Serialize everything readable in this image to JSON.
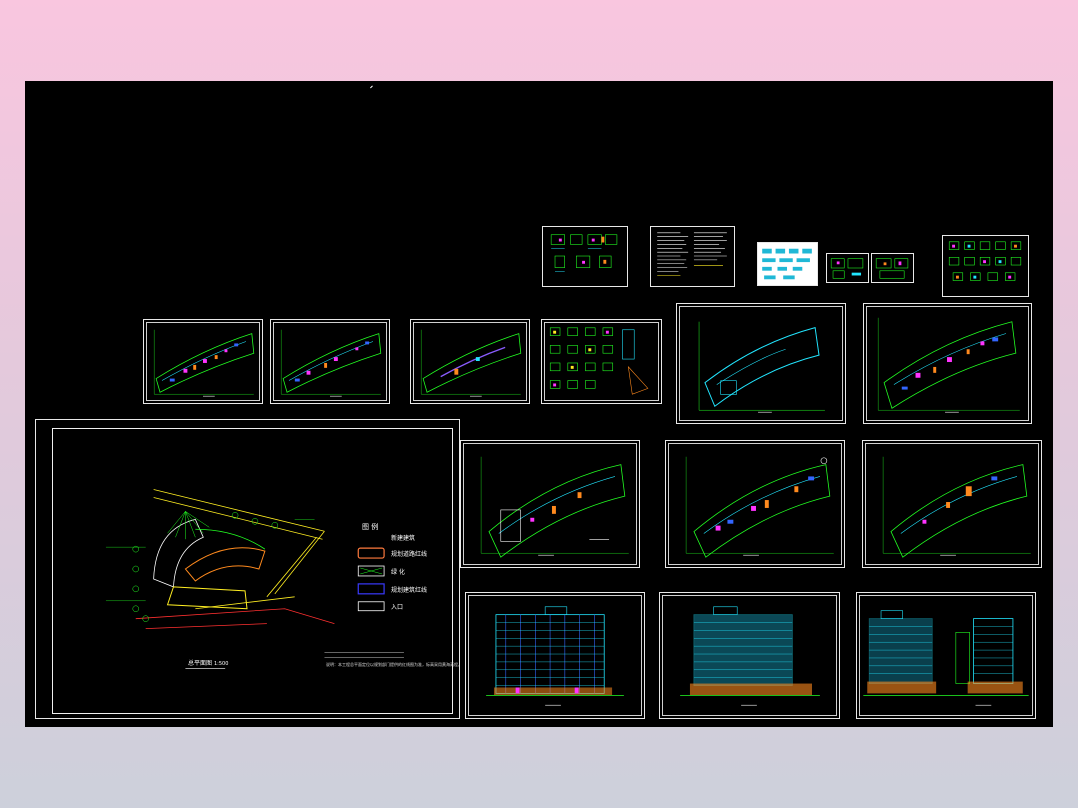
{
  "app": {
    "background_color": "#000000",
    "frame_gradient": [
      "#f9c6df",
      "#cdd0db"
    ]
  },
  "site_plan": {
    "title": "总平面图",
    "scale": "1:500",
    "legend_title": "图 例",
    "legend_items": [
      {
        "label": "新建建筑",
        "color": "#ffffff"
      },
      {
        "label": "规划道路红线",
        "color": "#ff7a3d"
      },
      {
        "label": "绿 化",
        "color": "#ffffff"
      },
      {
        "label": "规划建筑红线",
        "color": "#3a3aff"
      },
      {
        "label": "入口",
        "color": "#ffffff"
      }
    ],
    "note": "说明：本工程总平面定位以规划部门提供的红线图为准，标高采用黄海高程。"
  },
  "colors": {
    "line_green": "#22ff22",
    "line_cyan": "#22e6ff",
    "line_yellow": "#ffee22",
    "line_magenta": "#ff33ff",
    "line_orange": "#ff8a1e",
    "line_blue": "#3366ff",
    "line_red": "#ff3030",
    "sheet_border": "#e8e8e8"
  },
  "sheets": [
    {
      "name": "detail-sheet-1",
      "kind": "details"
    },
    {
      "name": "notes-sheet",
      "kind": "text"
    },
    {
      "name": "detail-sheet-2",
      "kind": "cyan-details"
    },
    {
      "name": "detail-sheet-3",
      "kind": "details"
    },
    {
      "name": "detail-sheet-4",
      "kind": "details"
    },
    {
      "name": "stair-details-sheet",
      "kind": "details"
    },
    {
      "name": "floor-plan-1",
      "kind": "plan"
    },
    {
      "name": "floor-plan-2",
      "kind": "plan"
    },
    {
      "name": "floor-plan-3",
      "kind": "plan"
    },
    {
      "name": "stair-plans-sheet",
      "kind": "details"
    },
    {
      "name": "roof-plan",
      "kind": "plan"
    },
    {
      "name": "floor-plan-4",
      "kind": "plan"
    },
    {
      "name": "floor-plan-5",
      "kind": "plan"
    },
    {
      "name": "floor-plan-6",
      "kind": "plan"
    },
    {
      "name": "floor-plan-7",
      "kind": "plan"
    },
    {
      "name": "elevation-1",
      "kind": "elevation"
    },
    {
      "name": "elevation-2",
      "kind": "elevation"
    },
    {
      "name": "elevation-3",
      "kind": "elevation"
    }
  ]
}
